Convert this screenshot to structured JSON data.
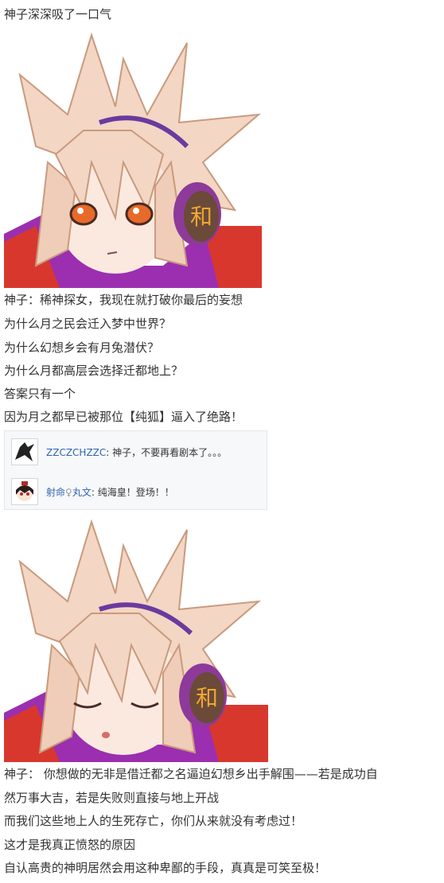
{
  "post": {
    "line1": "神子深深吸了一口气",
    "image1_glyph": "和",
    "line2": "神子：稀神探女，我现在就打破你最后的妄想",
    "line3": "为什么月之民会迁入梦中世界？",
    "line4": "为什么幻想乡会有月兔潜伏？",
    "line5": "为什么月都高层会选择迁都地上？",
    "line6": "答案只有一个",
    "line7": "因为月之都早已被那位【纯狐】逼入了绝路！",
    "image2_glyph": "和",
    "line8": "神子：   你想做的无非是借迁都之名逼迫幻想乡出手解围——若是成功自",
    "line9": "然万事大吉，若是失败则直接与地上开战",
    "line10": "而我们这些地上人的生死存亡，你们从来就没有考虑过！",
    "line11": "这才是我真正愤怒的原因",
    "line12": "自认高贵的神明居然会用这种卑鄙的手段，真真是可笑至极！"
  },
  "comments": [
    {
      "user": "ZZCZCHZZC",
      "colon": ":",
      "text": "神子，不要再看剧本了。。。",
      "avatar_icon": "crow-avatar-icon"
    },
    {
      "user_part1": "射命",
      "user_mark": "♀",
      "user_part2": "丸文",
      "colon": ":",
      "text": "纯海皇！登场！！",
      "avatar_icon": "aya-avatar-icon"
    }
  ],
  "colors": {
    "link": "#2d64b3",
    "comment_bg": "#f7f8fa",
    "text": "#333333",
    "hair": "#f3d6c3",
    "cape": "#9b2fb0",
    "earmuff": "#6b4a3a"
  }
}
